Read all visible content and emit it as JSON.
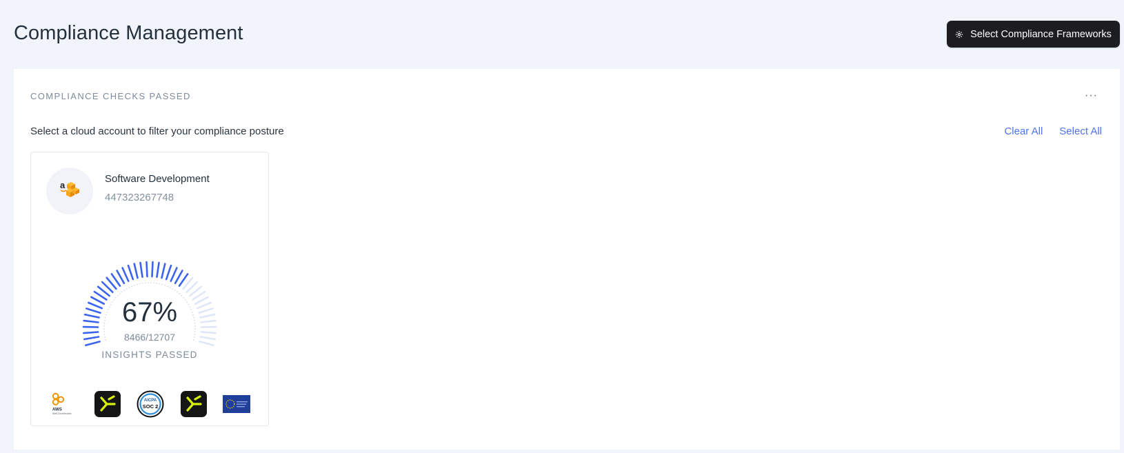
{
  "header": {
    "title": "Compliance Management",
    "select_frameworks_label": "Select Compliance Frameworks",
    "select_frameworks_icon": "gear-icon"
  },
  "card": {
    "section_title": "COMPLIANCE CHECKS PASSED",
    "more_icon": "more-horizontal-icon",
    "more_glyph": "···",
    "filter_text": "Select a cloud account to filter your compliance posture",
    "clear_all_label": "Clear All",
    "select_all_label": "Select All"
  },
  "account": {
    "name": "Software Development",
    "id": "447323267748",
    "provider_icon": "aws-logo-icon",
    "gauge": {
      "percent_value": 67,
      "percent_label": "67%",
      "passed": 8466,
      "total": 12707,
      "ratio_label": "8466/12707",
      "caption": "INSIGHTS PASSED",
      "active_color": "#3a63f0",
      "inactive_color": "#dfe6f7"
    },
    "frameworks": [
      {
        "icon": "aws-well-architected-icon",
        "text": "AWS",
        "subtext": "Well-Architected"
      },
      {
        "icon": "framework-arrow-logo-icon"
      },
      {
        "icon": "aicpa-soc2-icon",
        "text": "AICPA",
        "subtext": "SOC 2"
      },
      {
        "icon": "framework-arrow-logo-icon"
      },
      {
        "icon": "eu-flag-icon"
      }
    ]
  },
  "colors": {
    "page_bg": "#f1f4fb",
    "accent": "#4f73ea",
    "button_bg": "#1d1d21"
  }
}
